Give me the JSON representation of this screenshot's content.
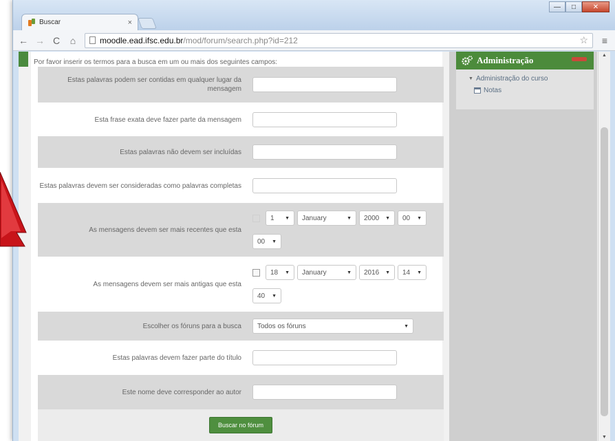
{
  "browser": {
    "tab_title": "Buscar",
    "tab_close": "×",
    "url_host": "moodle.ead.ifsc.edu.br",
    "url_path": "/mod/forum/search.php?id=212",
    "nav": {
      "back": "←",
      "forward": "→",
      "reload": "C",
      "home": "⌂"
    },
    "star": "☆",
    "menu": "≡",
    "window_controls": {
      "minimize": "—",
      "maximize": "□",
      "close": "✕"
    }
  },
  "form": {
    "intro": "Por favor inserir os termos para a busca em um ou mais dos seguintes campos:",
    "rows": [
      {
        "label": "Estas palavras podem ser contidas em qualquer lugar da mensagem"
      },
      {
        "label": "Esta frase exata deve fazer parte da mensagem"
      },
      {
        "label": "Estas palavras não devem ser incluídas"
      },
      {
        "label": "Estas palavras devem ser consideradas como palavras completas"
      },
      {
        "label": "As mensagens devem ser mais recentes que esta",
        "day": "1",
        "month": "January",
        "year": "2000",
        "hour": "00",
        "minute": "00"
      },
      {
        "label": "As mensagens devem ser mais antigas que esta",
        "day": "18",
        "month": "January",
        "year": "2016",
        "hour": "14",
        "minute": "40"
      },
      {
        "label": "Escolher os fóruns para a busca",
        "select": "Todos os fóruns"
      },
      {
        "label": "Estas palavras devem fazer parte do título"
      },
      {
        "label": "Este nome deve corresponder ao autor"
      }
    ],
    "submit": "Buscar no fórum"
  },
  "admin_block": {
    "title": "Administração",
    "item": "Administração do curso",
    "subitem": "Notas"
  },
  "scrollbar": {
    "up": "▲",
    "down": "▼"
  },
  "colors": {
    "moodle_green": "#4c8b3b",
    "accent_red": "#cc1a1a"
  }
}
